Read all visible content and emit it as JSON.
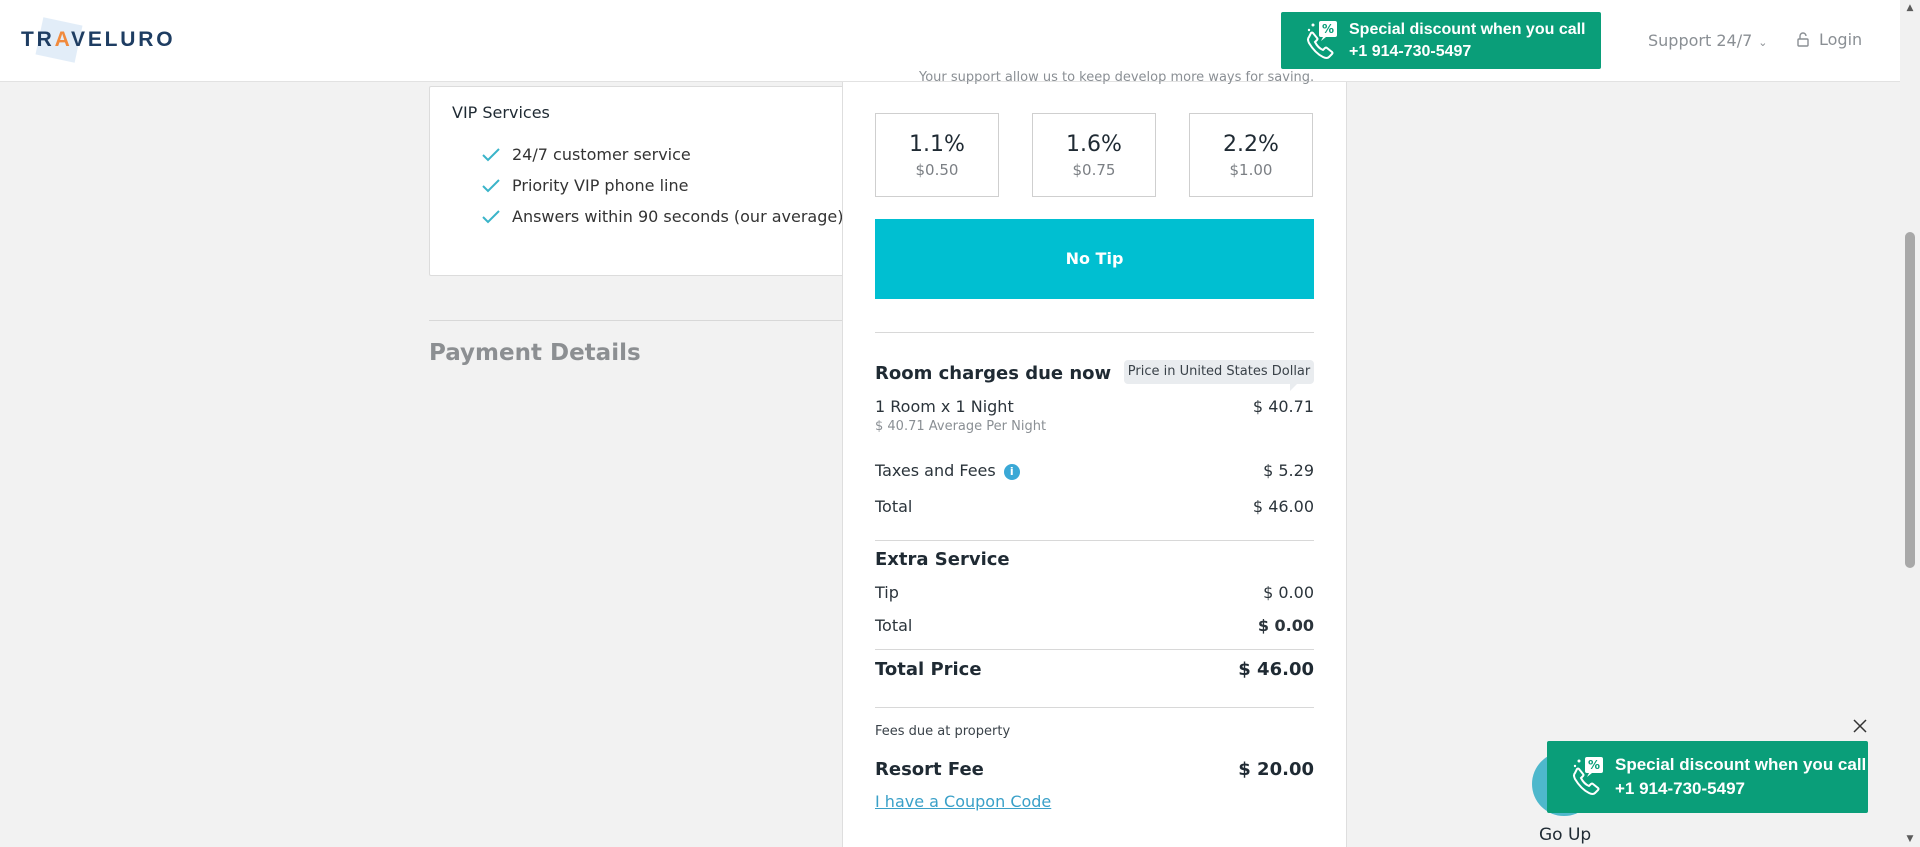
{
  "header": {
    "logo": {
      "t1": "TR",
      "a": "A",
      "t2": "VELURO"
    },
    "promo": {
      "line1": "Special discount when you call",
      "line2": "+1 914-730-5497",
      "icon": "phone-discount-icon"
    },
    "support_label": "Support 24/7",
    "login_label": "Login"
  },
  "vip": {
    "title": "VIP Services",
    "items": [
      "24/7 customer service",
      "Priority VIP phone line",
      "Answers within 90 seconds (our average)"
    ]
  },
  "payment_title": "Payment Details",
  "summary": {
    "note": "Your support allow us to keep develop more ways for saving.",
    "tips": [
      {
        "pct": "1.1%",
        "amount": "$0.50"
      },
      {
        "pct": "1.6%",
        "amount": "$0.75"
      },
      {
        "pct": "2.2%",
        "amount": "$1.00"
      }
    ],
    "no_tip_label": "No Tip",
    "room_section": "Room charges due now",
    "currency_badge": "Price in United States Dollar",
    "room_line": "1 Room x 1 Night",
    "room_line_value": "$ 40.71",
    "room_avg": "$ 40.71 Average Per Night",
    "taxes_label": "Taxes and Fees",
    "taxes_value": "$ 5.29",
    "room_total_label": "Total",
    "room_total_value": "$ 46.00",
    "extra_section": "Extra Service",
    "tip_label": "Tip",
    "tip_value": "$ 0.00",
    "extra_total_label": "Total",
    "extra_total_value": "$ 0.00",
    "total_price_label": "Total Price",
    "total_price_value": "$ 46.00",
    "fees_property": "Fees due at property",
    "resort_fee_label": "Resort Fee",
    "resort_fee_value": "$ 20.00",
    "coupon_link": "I have a Coupon Code"
  },
  "go_up_label": "Go Up",
  "colors": {
    "accent": "#00bfd1",
    "promo": "#0a9e79",
    "brand": "#1e3d62"
  }
}
